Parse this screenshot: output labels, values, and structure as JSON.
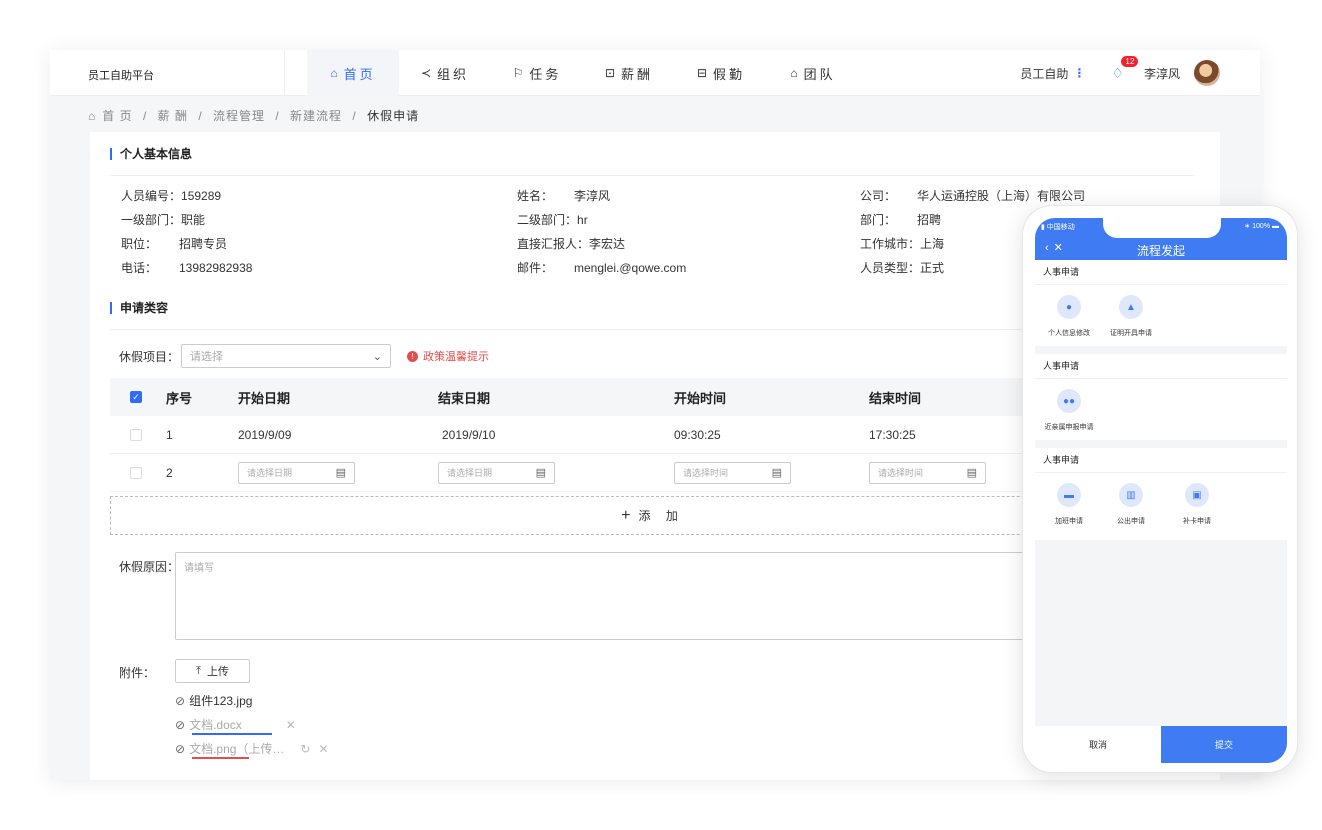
{
  "header": {
    "brand": "员工自助平台",
    "nav": [
      {
        "icon": "⌂",
        "label": "首页",
        "active": true
      },
      {
        "icon": "≺",
        "label": "组织",
        "active": false
      },
      {
        "icon": "⚐",
        "label": "任务",
        "active": false
      },
      {
        "icon": "⊡",
        "label": "薪酬",
        "active": false
      },
      {
        "icon": "⊟",
        "label": "假勤",
        "active": false
      },
      {
        "icon": "⌂",
        "label": "团队",
        "active": false
      }
    ],
    "self_service": "员工自助",
    "notification_count": "12",
    "user_name": "李淳风"
  },
  "breadcrumb": {
    "home": "首 页",
    "items": [
      "薪 酬",
      "流程管理",
      "新建流程"
    ],
    "current": "休假申请",
    "separator": "/"
  },
  "personal": {
    "title": "个人基本信息",
    "col1": [
      {
        "label": "人员编号：",
        "value": "159289"
      },
      {
        "label": "一级部门：",
        "value": "职能"
      },
      {
        "label": "职位：",
        "value": "招聘专员"
      },
      {
        "label": "电话：",
        "value": "13982982938"
      }
    ],
    "col2": [
      {
        "label": "姓名：",
        "value": "李淳风"
      },
      {
        "label": "二级部门：",
        "value": "hr"
      },
      {
        "label": "直接汇报人：",
        "value": "李宏达"
      },
      {
        "label": "邮件：",
        "value": "menglei.@qowe.com"
      }
    ],
    "col3": [
      {
        "label": "公司：",
        "value": "华人运通控股（上海）有限公司"
      },
      {
        "label": "部门：",
        "value": "招聘"
      },
      {
        "label": "工作城市：",
        "value": "上海"
      },
      {
        "label": "人员类型：",
        "value": "正式"
      }
    ]
  },
  "application": {
    "title": "申请类容",
    "leave_item_label": "休假项目：",
    "leave_item_placeholder": "请选择",
    "policy_tip": "政策温馨提示",
    "table": {
      "headers": [
        "序号",
        "开始日期",
        "结束日期",
        "开始时间",
        "结束时间"
      ],
      "rows": [
        {
          "no": "1",
          "start_date": "2019/9/09",
          "end_date": "2019/9/10",
          "start_time": "09:30:25",
          "end_time": "17:30:25"
        }
      ],
      "new_row": {
        "no": "2",
        "date_placeholder": "请选择日期",
        "time_placeholder": "请选择时间"
      }
    },
    "add_label": "添 加",
    "reason_label": "休假原因：",
    "reason_placeholder": "请填写",
    "attachment_label": "附件：",
    "upload_label": "上传",
    "files": [
      {
        "name": "组件123.jpg",
        "state": "done"
      },
      {
        "name": "文档.docx",
        "state": "uploading"
      },
      {
        "name": "文档.png（上传…",
        "state": "error"
      }
    ]
  },
  "phone": {
    "carrier": "中国移动",
    "battery": "100%",
    "title": "流程发起",
    "groups": [
      {
        "title": "人事申请",
        "items": [
          {
            "icon": "person-icon",
            "label": "个人信息修改"
          },
          {
            "icon": "stamp-icon",
            "label": "证明开具申请"
          }
        ]
      },
      {
        "title": "人事申请",
        "items": [
          {
            "icon": "people-icon",
            "label": "近亲属申报申请"
          }
        ]
      },
      {
        "title": "人事申请",
        "items": [
          {
            "icon": "overtime-icon",
            "label": "加班申请"
          },
          {
            "icon": "briefcase-icon",
            "label": "公出申请"
          },
          {
            "icon": "calendar-check-icon",
            "label": "补卡申请"
          }
        ]
      }
    ],
    "cancel": "取消",
    "submit": "提交"
  },
  "colors": {
    "primary": "#2f6bff",
    "phone_primary": "#3f7cf4",
    "warning": "#e34d4d"
  }
}
